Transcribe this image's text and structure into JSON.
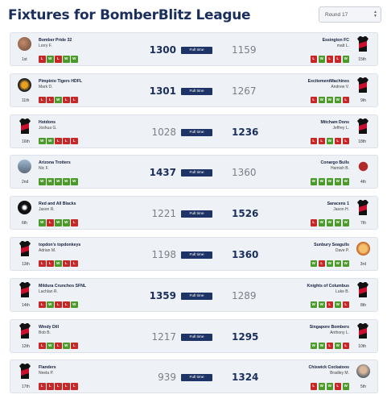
{
  "page": {
    "title": "Fixtures for BomberBlitz League",
    "round_select": "Round 17",
    "status_label": "Full time"
  },
  "colors": {
    "win": "#4c9a2a",
    "loss": "#c62828",
    "status_bg": "#1f3466",
    "title": "#1b2f5c",
    "jersey_red": "#c8102e",
    "jersey_black": "#111111"
  },
  "matches": [
    {
      "home": {
        "name": "Bomber Pride 32",
        "coach": "Lorry F.",
        "rank": "1st",
        "score": "1300",
        "form": [
          "L",
          "W",
          "L",
          "W",
          "W"
        ],
        "logo": "team-photo-icon"
      },
      "away": {
        "name": "Essington FC",
        "coach": "matt L.",
        "rank": "15th",
        "score": "1159",
        "form": [
          "L",
          "W",
          "L",
          "L",
          "W"
        ],
        "logo": "jersey-icon"
      },
      "winner": "home"
    },
    {
      "home": {
        "name": "Pimpinio Tigers HDFL",
        "coach": "Mark D.",
        "rank": "11th",
        "score": "1301",
        "form": [
          "L",
          "L",
          "W",
          "L",
          "L"
        ],
        "logo": "tiger-icon"
      },
      "away": {
        "name": "ExcitementMachines",
        "coach": "Andrew V.",
        "rank": "9th",
        "score": "1267",
        "form": [
          "L",
          "W",
          "W",
          "W",
          "L"
        ],
        "logo": "jersey-icon"
      },
      "winner": "home"
    },
    {
      "home": {
        "name": "Hotdons",
        "coach": "Joshua G.",
        "rank": "16th",
        "score": "1028",
        "form": [
          "W",
          "W",
          "L",
          "L",
          "L"
        ],
        "logo": "jersey-icon"
      },
      "away": {
        "name": "Mitcham Dons",
        "coach": "Jeffrey L.",
        "rank": "18th",
        "score": "1236",
        "form": [
          "L",
          "L",
          "W",
          "L",
          "L"
        ],
        "logo": "jersey-icon"
      },
      "winner": "away"
    },
    {
      "home": {
        "name": "Arizona Trotters",
        "coach": "Nic F.",
        "rank": "2nd",
        "score": "1437",
        "form": [
          "W",
          "W",
          "W",
          "W",
          "W"
        ],
        "logo": "photo-icon"
      },
      "away": {
        "name": "Conargo Bulls",
        "coach": "Hamish B.",
        "rank": "4th",
        "score": "1360",
        "form": [
          "W",
          "W",
          "W",
          "W",
          "W"
        ],
        "logo": "bull-icon"
      },
      "winner": "home"
    },
    {
      "home": {
        "name": "Red and All Blacks",
        "coach": "Jason R.",
        "rank": "6th",
        "score": "1221",
        "form": [
          "W",
          "L",
          "W",
          "W",
          "L"
        ],
        "logo": "fern-icon"
      },
      "away": {
        "name": "Saracens 1",
        "coach": "Jason H.",
        "rank": "7th",
        "score": "1526",
        "form": [
          "L",
          "W",
          "W",
          "W",
          "W"
        ],
        "logo": "jersey-icon"
      },
      "winner": "away"
    },
    {
      "home": {
        "name": "topdon's topdonkeys",
        "coach": "Adrian M.",
        "rank": "13th",
        "score": "1198",
        "form": [
          "L",
          "L",
          "W",
          "L",
          "L"
        ],
        "logo": "jersey-icon"
      },
      "away": {
        "name": "Sunbury Seagulls",
        "coach": "Dave P.",
        "rank": "3rd",
        "score": "1360",
        "form": [
          "W",
          "L",
          "W",
          "W",
          "W"
        ],
        "logo": "seagull-icon"
      },
      "winner": "away"
    },
    {
      "home": {
        "name": "Mildura Crunchos SFNL",
        "coach": "Lachlan R.",
        "rank": "14th",
        "score": "1359",
        "form": [
          "L",
          "W",
          "L",
          "L",
          "W"
        ],
        "logo": "jersey-icon"
      },
      "away": {
        "name": "Knights of Columbus",
        "coach": "Luke B.",
        "rank": "8th",
        "score": "1289",
        "form": [
          "W",
          "W",
          "L",
          "W",
          "L"
        ],
        "logo": "jersey-icon"
      },
      "winner": "home"
    },
    {
      "home": {
        "name": "Windy Dill",
        "coach": "Bob B.",
        "rank": "12th",
        "score": "1217",
        "form": [
          "L",
          "W",
          "L",
          "W",
          "L"
        ],
        "logo": "jersey-icon"
      },
      "away": {
        "name": "Singapore Bombers",
        "coach": "Anthony L.",
        "rank": "10th",
        "score": "1295",
        "form": [
          "W",
          "W",
          "L",
          "W",
          "L"
        ],
        "logo": "jersey-icon"
      },
      "winner": "away"
    },
    {
      "home": {
        "name": "Flanders",
        "coach": "Neela P.",
        "rank": "17th",
        "score": "939",
        "form": [
          "L",
          "L",
          "L",
          "L",
          "L"
        ],
        "logo": "jersey-icon"
      },
      "away": {
        "name": "Chiswick Cockatoos",
        "coach": "Bradley M.",
        "rank": "5th",
        "score": "1324",
        "form": [
          "L",
          "W",
          "W",
          "L",
          "W"
        ],
        "logo": "person-photo-icon"
      },
      "winner": "away"
    }
  ]
}
